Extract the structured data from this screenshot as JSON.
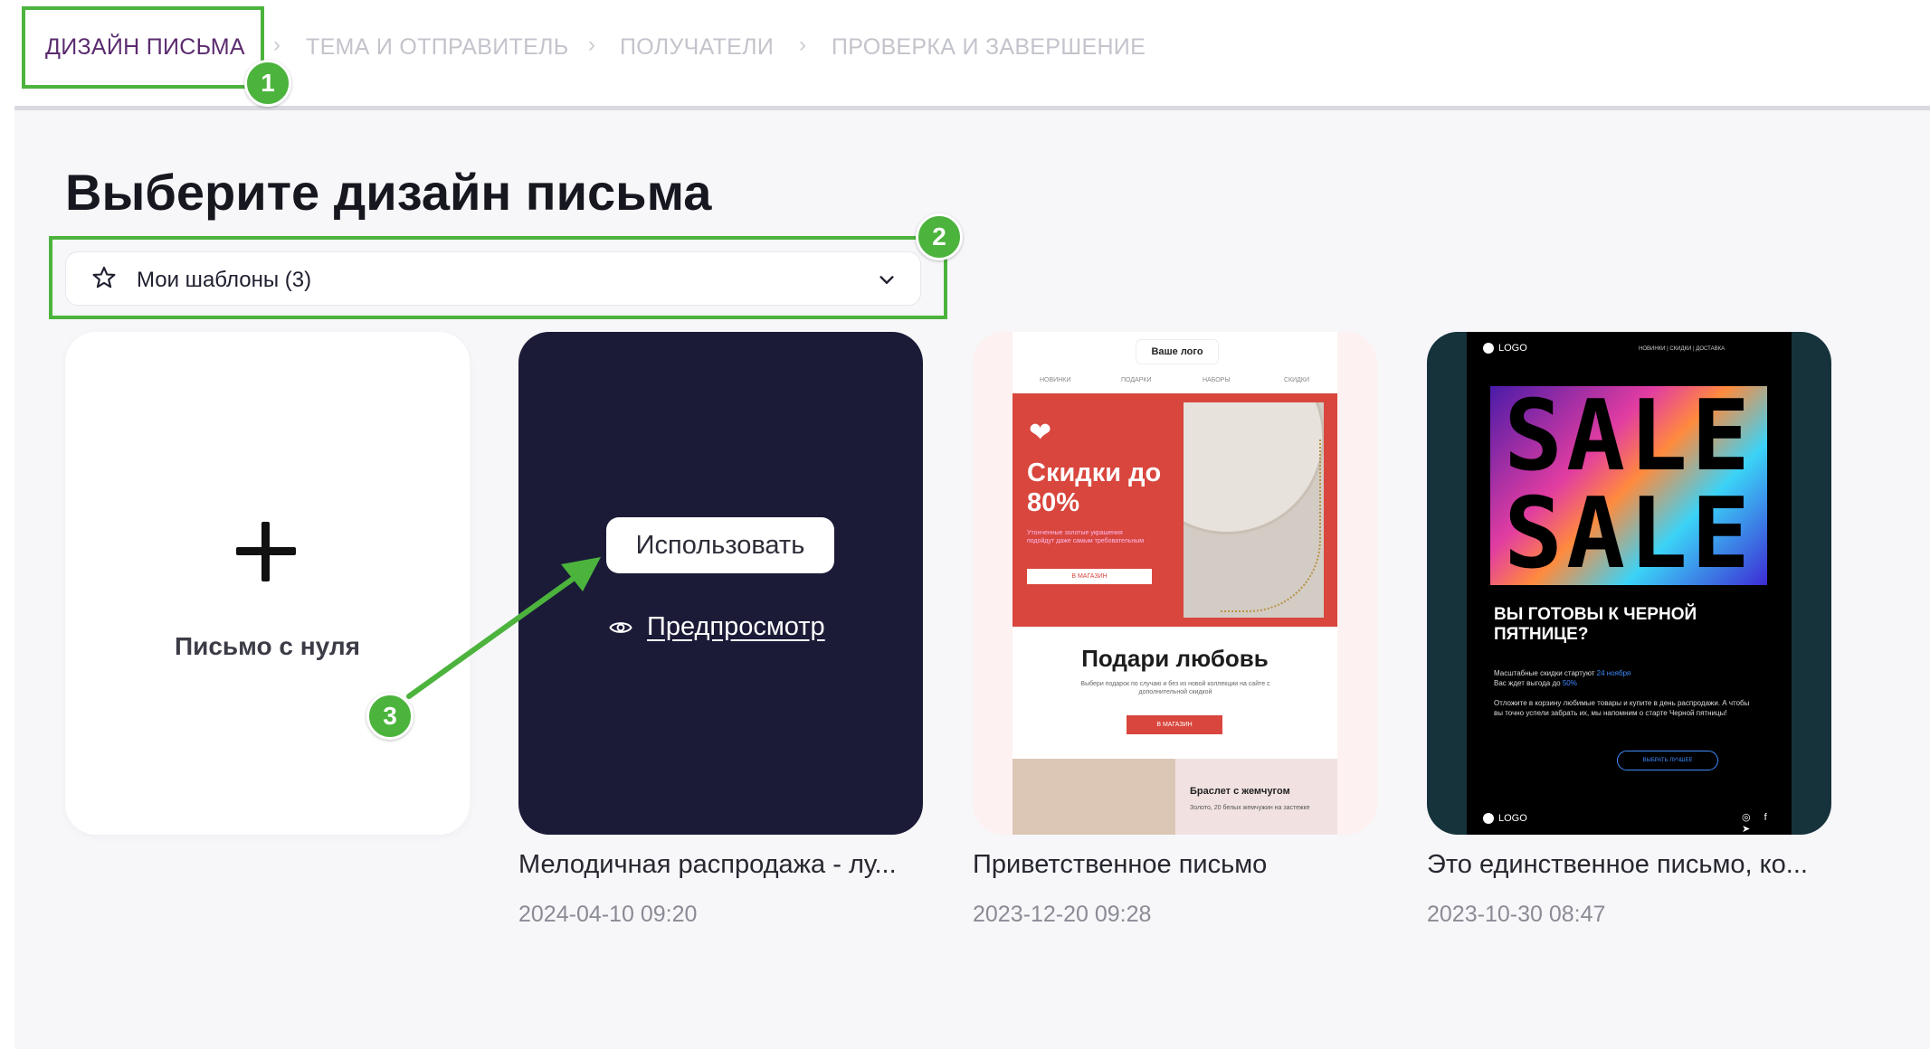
{
  "stepper": {
    "steps": [
      {
        "label": "ДИЗАЙН ПИСЬМА"
      },
      {
        "label": "ТЕМА И ОТПРАВИТЕЛЬ"
      },
      {
        "label": "ПОЛУЧАТЕЛИ"
      },
      {
        "label": "ПРОВЕРКА И ЗАВЕРШЕНИЕ"
      }
    ]
  },
  "annotations": {
    "badge1": "1",
    "badge2": "2",
    "badge3": "3"
  },
  "page": {
    "title": "Выберите дизайн письма"
  },
  "filter": {
    "icon": "star-icon",
    "selected": "Мои шаблоны (3)"
  },
  "blank_card": {
    "label": "Письмо с нуля"
  },
  "hover_actions": {
    "use": "Использовать",
    "preview": "Предпросмотр"
  },
  "templates": [
    {
      "name": "Мелодичная распродажа - лу...",
      "date": "2024-04-10 09:20"
    },
    {
      "name": "Приветственное письмо",
      "date": "2023-12-20 09:28"
    },
    {
      "name": "Это единственное письмо, ко...",
      "date": "2023-10-30 08:47"
    }
  ],
  "thumb_welcome": {
    "logo": "Ваше лого",
    "nav": [
      "НОВИНКИ",
      "ПОДАРКИ",
      "НАБОРЫ",
      "СКИДКИ"
    ],
    "headline": "Скидки до 80%",
    "small": "Утонченные золотые украшения подойдут даже самым требовательным",
    "button": "В МАГАЗИН",
    "title": "Подари любовь",
    "sub": "Выбери подарок по случаю и без из новой коллекции на сайте с дополнительной скидкой",
    "button2": "В МАГАЗИН",
    "bracelet": "Браслет с жемчугом",
    "bracelet_sub": "Золото, 20 белых жемчужин на застежке"
  },
  "thumb_sale": {
    "logo": "LOGO",
    "nav": "НОВИНКИ | СКИДКИ | ДОСТАВКА",
    "word1": "SALE",
    "word2": "SALE",
    "question": "ВЫ ГОТОВЫ К ЧЕРНОЙ ПЯТНИЦЕ?",
    "p1": "Масштабные скидки стартуют",
    "p1_date": "24 ноября",
    "p2": "Вас ждет выгода до",
    "p2_pct": "50%",
    "p3": "Отложите в корзину любимые товары и купите в день распродажи. А чтобы вы точно успели забрать их, мы напомним о старте Черной пятницы!",
    "button": "ВЫБРАТЬ ЛУЧШЕЕ",
    "footer_logo": "LOGO",
    "social": "◎ f ➤"
  },
  "colors": {
    "accent": "#5b2c6f",
    "annotation_green": "#4cb33d",
    "dark_card": "#1b1b38",
    "background": "#f7f7fa"
  }
}
